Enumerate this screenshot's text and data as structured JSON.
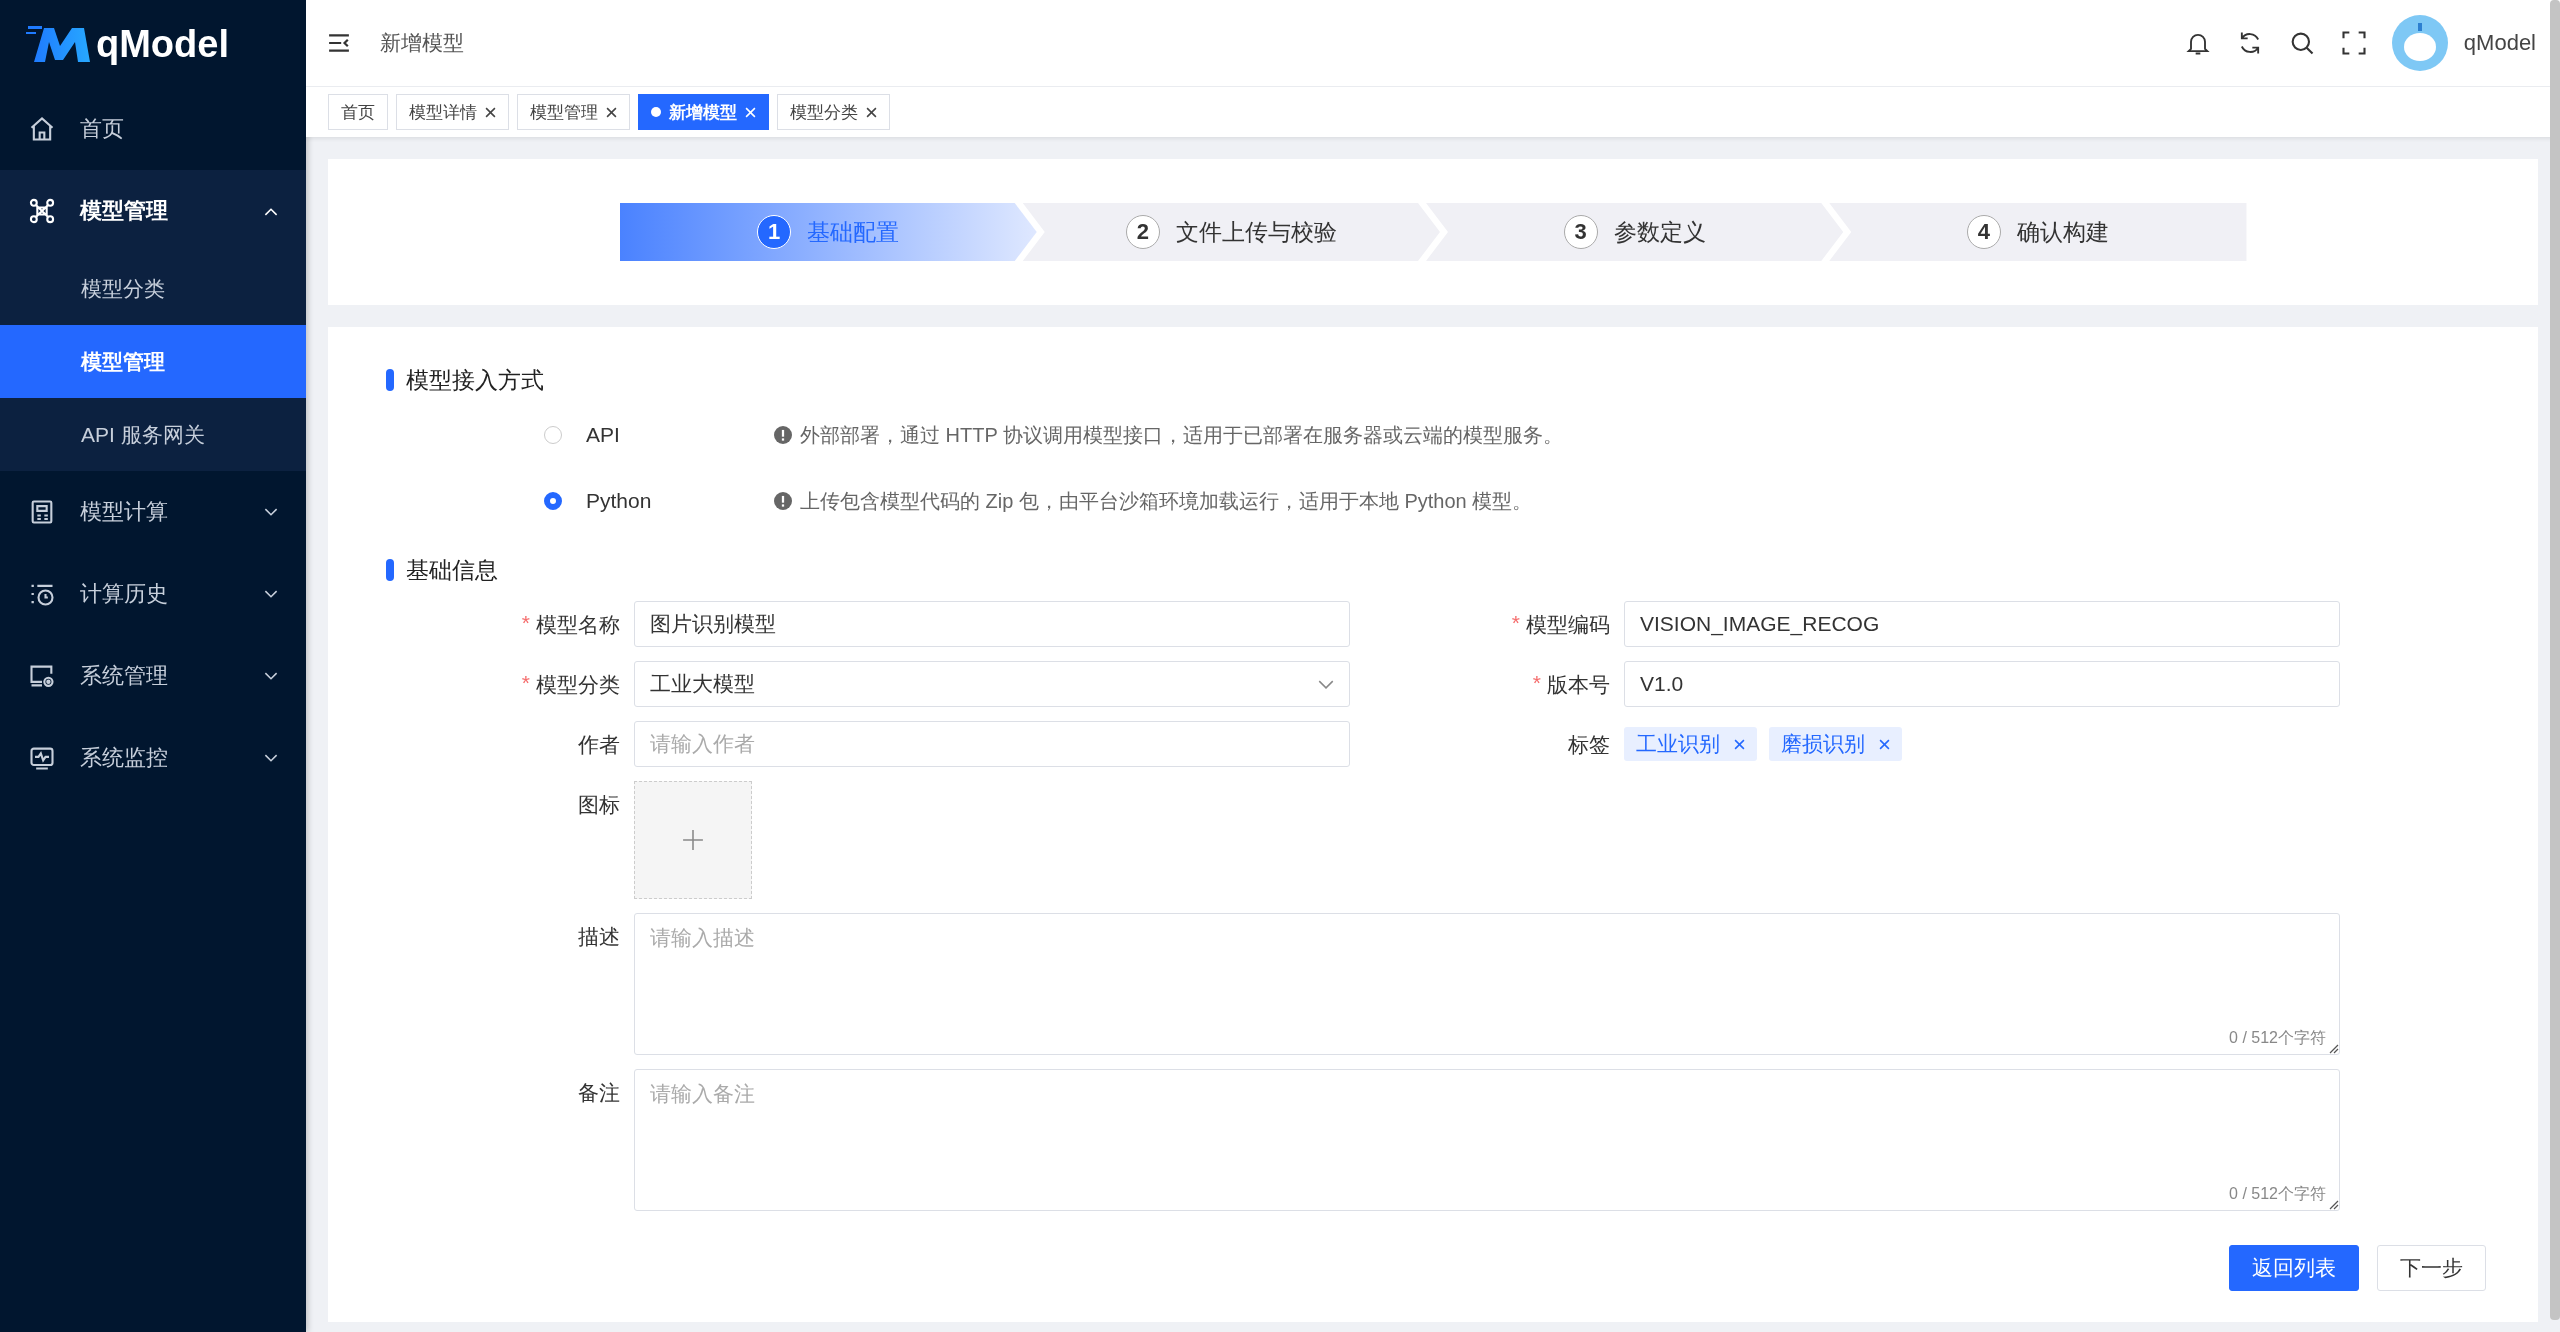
{
  "brand": {
    "name": "qModel"
  },
  "sidebar": {
    "items": [
      {
        "label": "首页",
        "kind": "link",
        "expanded": false
      },
      {
        "label": "模型管理",
        "kind": "group",
        "expanded": true,
        "children": [
          {
            "label": "模型分类",
            "selected": false
          },
          {
            "label": "模型管理",
            "selected": true
          },
          {
            "label": "API 服务网关",
            "selected": false
          }
        ]
      },
      {
        "label": "模型计算",
        "kind": "group",
        "expanded": false
      },
      {
        "label": "计算历史",
        "kind": "group",
        "expanded": false
      },
      {
        "label": "系统管理",
        "kind": "group",
        "expanded": false
      },
      {
        "label": "系统监控",
        "kind": "group",
        "expanded": false
      }
    ]
  },
  "header": {
    "title": "新增模型",
    "user": "qModel"
  },
  "tabs": [
    {
      "label": "首页",
      "selected": false,
      "closable": false
    },
    {
      "label": "模型详情",
      "selected": false,
      "closable": true
    },
    {
      "label": "模型管理",
      "selected": false,
      "closable": true
    },
    {
      "label": "新增模型",
      "selected": true,
      "closable": true
    },
    {
      "label": "模型分类",
      "selected": false,
      "closable": true
    }
  ],
  "steps": [
    {
      "number": "1",
      "label": "基础配置",
      "selected": true
    },
    {
      "number": "2",
      "label": "文件上传与校验",
      "selected": false
    },
    {
      "number": "3",
      "label": "参数定义",
      "selected": false
    },
    {
      "number": "4",
      "label": "确认构建",
      "selected": false
    }
  ],
  "access_section": {
    "title": "模型接入方式",
    "options": [
      {
        "label": "API",
        "selected": false,
        "description": "外部部署，通过 HTTP 协议调用模型接口，适用于已部署在服务器或云端的模型服务。"
      },
      {
        "label": "Python",
        "selected": true,
        "description": "上传包含模型代码的 Zip 包，由平台沙箱环境加载运行，适用于本地 Python 模型。"
      }
    ]
  },
  "info_section": {
    "title": "基础信息",
    "rows": [
      {
        "fields": [
          {
            "label": "模型名称",
            "required_mark": "*",
            "kind": "input",
            "value": "图片识别模型"
          },
          {
            "label": "模型编码",
            "required_mark": "*",
            "kind": "input",
            "value": "VISION_IMAGE_RECOG"
          }
        ]
      },
      {
        "fields": [
          {
            "label": "模型分类",
            "required_mark": "*",
            "kind": "select",
            "value": "工业大模型"
          },
          {
            "label": "版本号",
            "required_mark": "*",
            "kind": "input",
            "value": "V1.0"
          }
        ]
      },
      {
        "fields": [
          {
            "label": "作者",
            "kind": "input",
            "placeholder": "请输入作者"
          },
          {
            "label": "标签",
            "kind": "tags",
            "tags": [
              "工业识别",
              "磨损识别"
            ]
          }
        ]
      },
      {
        "fields": [
          {
            "label": "图标",
            "kind": "upload"
          }
        ]
      },
      {
        "fields": [
          {
            "label": "描述",
            "kind": "textarea",
            "placeholder": "请输入描述",
            "counter": "0 / 512个字符"
          }
        ]
      },
      {
        "fields": [
          {
            "label": "备注",
            "kind": "textarea",
            "placeholder": "请输入备注",
            "counter": "0 / 512个字符"
          }
        ]
      }
    ]
  },
  "buttons": [
    {
      "label": "返回列表",
      "kind": "primary"
    },
    {
      "label": "下一步",
      "kind": "default"
    }
  ]
}
